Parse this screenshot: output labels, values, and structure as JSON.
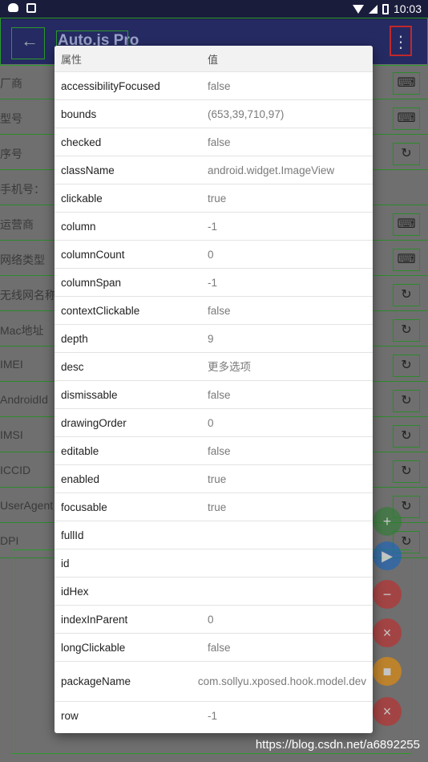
{
  "status_bar": {
    "time": "10:03"
  },
  "app_bar": {
    "title": "Auto.js Pro"
  },
  "background_rows": [
    {
      "label": "厂商",
      "action": "⌨"
    },
    {
      "label": "型号",
      "action": "⌨"
    },
    {
      "label": "序号",
      "action": "↻"
    },
    {
      "label": "手机号：",
      "action": ""
    },
    {
      "label": "运营商",
      "action": "⌨"
    },
    {
      "label": "网络类型",
      "action": "⌨"
    },
    {
      "label": "无线网名称",
      "action": "↻"
    },
    {
      "label": "Mac地址",
      "action": "↻"
    },
    {
      "label": "IMEI",
      "action": "↻"
    },
    {
      "label": "AndroidId",
      "action": "↻"
    },
    {
      "label": "IMSI",
      "action": "↻"
    },
    {
      "label": "ICCID",
      "action": "↻"
    },
    {
      "label": "UserAgent",
      "action": "↻"
    },
    {
      "label": "DPI",
      "action": "↻"
    }
  ],
  "fabs": [
    {
      "icon": "+",
      "color": "#2e7d32"
    },
    {
      "icon": "▶",
      "color": "#1565c0"
    },
    {
      "icon": "−",
      "color": "#c62828"
    },
    {
      "icon": "×",
      "color": "#c62828"
    },
    {
      "icon": "■",
      "color": "#ef8f00"
    },
    {
      "icon": "×",
      "color": "#c62828"
    }
  ],
  "dialog": {
    "header_attr": "属性",
    "header_value": "值",
    "rows": [
      {
        "attr": "accessibilityFocused",
        "value": "false"
      },
      {
        "attr": "bounds",
        "value": "(653,39,710,97)"
      },
      {
        "attr": "checked",
        "value": "false"
      },
      {
        "attr": "className",
        "value": "android.widget.ImageView"
      },
      {
        "attr": "clickable",
        "value": "true"
      },
      {
        "attr": "column",
        "value": "-1"
      },
      {
        "attr": "columnCount",
        "value": "0"
      },
      {
        "attr": "columnSpan",
        "value": "-1"
      },
      {
        "attr": "contextClickable",
        "value": "false"
      },
      {
        "attr": "depth",
        "value": "9"
      },
      {
        "attr": "desc",
        "value": "更多选项"
      },
      {
        "attr": "dismissable",
        "value": "false"
      },
      {
        "attr": "drawingOrder",
        "value": "0"
      },
      {
        "attr": "editable",
        "value": "false"
      },
      {
        "attr": "enabled",
        "value": "true"
      },
      {
        "attr": "focusable",
        "value": "true"
      },
      {
        "attr": "fullId",
        "value": ""
      },
      {
        "attr": "id",
        "value": ""
      },
      {
        "attr": "idHex",
        "value": ""
      },
      {
        "attr": "indexInParent",
        "value": "0"
      },
      {
        "attr": "longClickable",
        "value": "false"
      },
      {
        "attr": "packageName",
        "value": "com.sollyu.xposed.hook.model.dev"
      },
      {
        "attr": "row",
        "value": "-1"
      }
    ]
  },
  "watermark": "https://blog.csdn.net/a6892255"
}
